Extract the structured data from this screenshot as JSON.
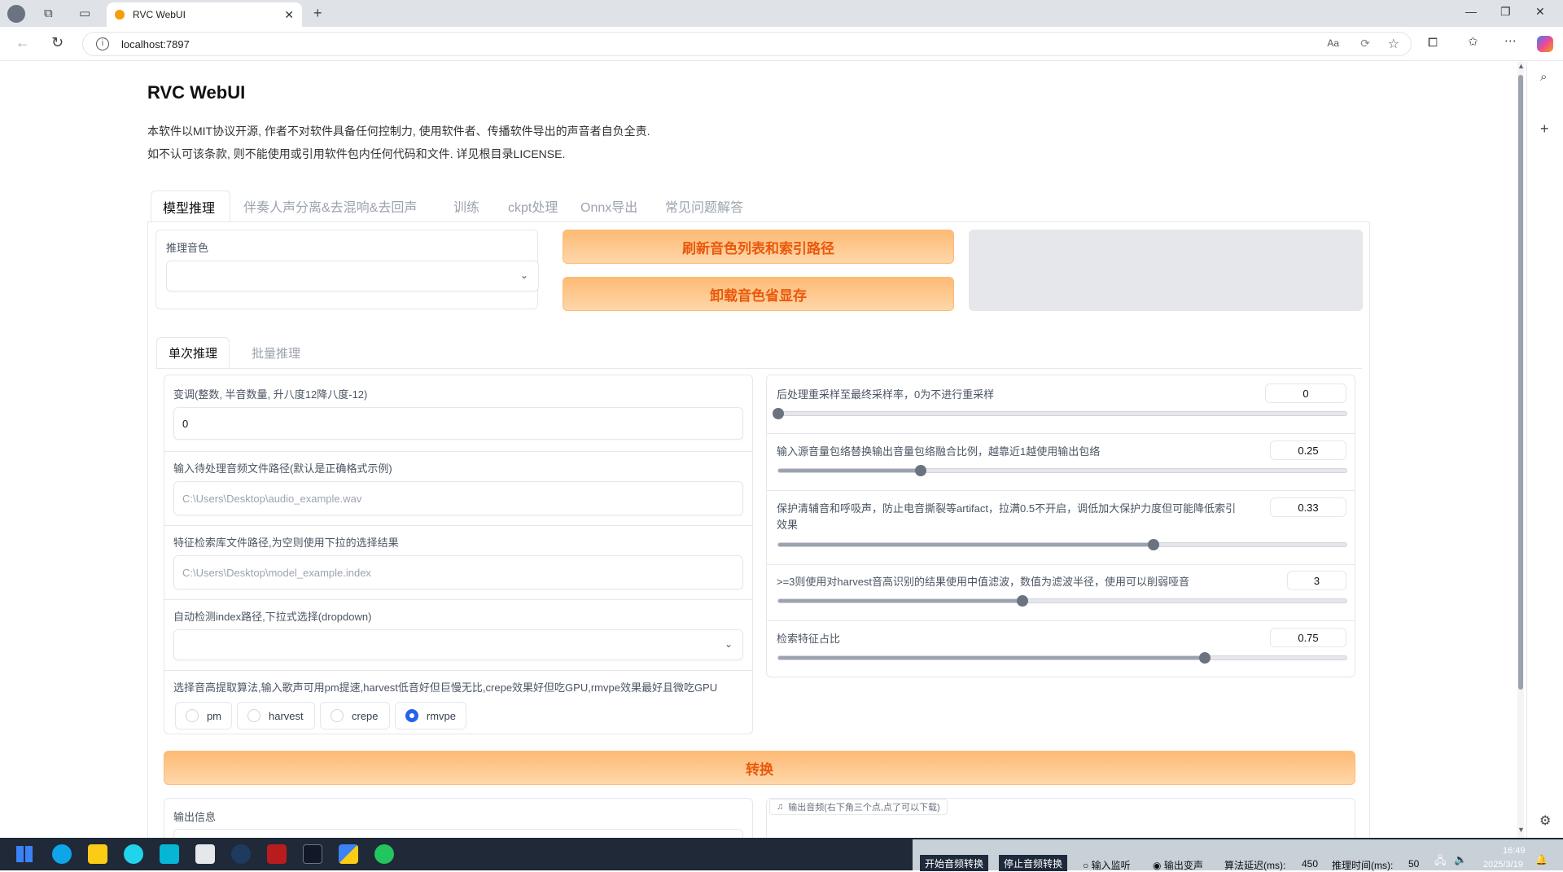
{
  "browser": {
    "tab_title": "RVC WebUI",
    "address": "localhost:7897"
  },
  "page": {
    "title": "RVC WebUI",
    "notice_line1": "本软件以MIT协议开源, 作者不对软件具备任何控制力, 使用软件者、传播软件导出的声音者自负全责.",
    "notice_line2": "如不认可该条款, 则不能使用或引用软件包内任何代码和文件. 详见根目录LICENSE."
  },
  "top_tabs": [
    "模型推理",
    "伴奏人声分离&去混响&去回声",
    "训练",
    "ckpt处理",
    "Onnx导出",
    "常见问题解答"
  ],
  "voice_select": {
    "label": "推理音色",
    "value": ""
  },
  "buttons": {
    "refresh": "刷新音色列表和索引路径",
    "unload": "卸载音色省显存",
    "convert": "转换"
  },
  "sub_tabs": [
    "单次推理",
    "批量推理"
  ],
  "left_form": {
    "pitch": {
      "label": "变调(整数, 半音数量, 升八度12降八度-12)",
      "value": "0"
    },
    "audio_path": {
      "label": "输入待处理音频文件路径(默认是正确格式示例)",
      "placeholder": "C:\\Users\\Desktop\\audio_example.wav"
    },
    "index_path": {
      "label": "特征检索库文件路径,为空则使用下拉的选择结果",
      "placeholder": "C:\\Users\\Desktop\\model_example.index"
    },
    "auto_index": {
      "label": "自动检测index路径,下拉式选择(dropdown)",
      "value": ""
    },
    "f0_method": {
      "label": "选择音高提取算法,输入歌声可用pm提速,harvest低音好但巨慢无比,crepe效果好但吃GPU,rmvpe效果最好且微吃GPU",
      "options": [
        "pm",
        "harvest",
        "crepe",
        "rmvpe"
      ],
      "selected": "rmvpe"
    },
    "output_info": {
      "label": "输出信息"
    }
  },
  "right_sliders": [
    {
      "label": "后处理重采样至最终采样率，0为不进行重采样",
      "value": "0",
      "fraction": 0.0
    },
    {
      "label": "输入源音量包络替换输出音量包络融合比例，越靠近1越使用输出包络",
      "value": "0.25",
      "fraction": 0.25
    },
    {
      "label": "保护清辅音和呼吸声，防止电音撕裂等artifact，拉满0.5不开启，调低加大保护力度但可能降低索引",
      "label2": "效果",
      "value": "0.33",
      "fraction": 0.66
    },
    {
      "label": ">=3则使用对harvest音高识别的结果使用中值滤波，数值为滤波半径，使用可以削弱哑音",
      "value": "3",
      "fraction": 0.43
    },
    {
      "label": "检索特征占比",
      "value": "0.75",
      "fraction": 0.75
    }
  ],
  "output_audio": {
    "label": "输出音频(右下角三个点,点了可以下载)"
  },
  "taskbar": {
    "btn_start": "开始音频转换",
    "btn_stop": "停止音频转换",
    "monitor_in": "输入监听",
    "monitor_out": "输出变声",
    "latency_label": "算法延迟(ms):",
    "latency_value": "450",
    "infer_label": "推理时间(ms):",
    "infer_value": "50",
    "clock_time": "16:49",
    "clock_date": "2025/3/19"
  }
}
